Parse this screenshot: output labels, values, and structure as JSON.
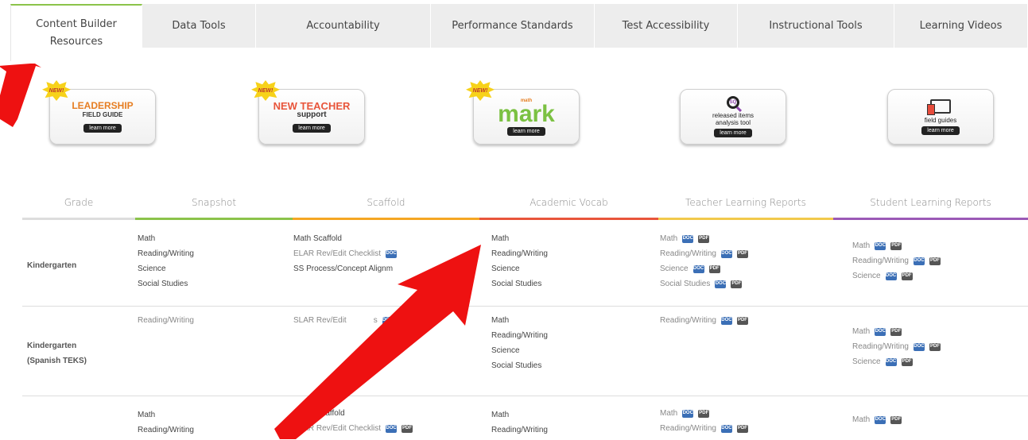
{
  "tabs": [
    {
      "label": "Content Builder\nResources",
      "active": true
    },
    {
      "label": "Data Tools"
    },
    {
      "label": "Accountability"
    },
    {
      "label": "Performance Standards"
    },
    {
      "label": "Test Accessibility"
    },
    {
      "label": "Instructional Tools"
    },
    {
      "label": "Learning Videos"
    }
  ],
  "banners": {
    "badge": "NEW!",
    "learn_more": "learn more",
    "leadership": {
      "title": "LEADERSHIP",
      "sub": "FIELD GUIDE"
    },
    "new_teacher": {
      "title": "NEW TEACHER",
      "sub": "support"
    },
    "math_mark": {
      "top": "math",
      "title": "mark"
    },
    "released": {
      "icon": "SQ",
      "text": "released items\nanalysis tool"
    },
    "field_guides": {
      "text": "field guides"
    }
  },
  "table": {
    "headers": [
      "Grade",
      "Snapshot",
      "Scaffold",
      "Academic Vocab",
      "Teacher Learning Reports",
      "Student Learning Reports"
    ],
    "bar_colors": [
      "#5bc0eb",
      "#8bc34a",
      "#f5a623",
      "#e8553b",
      "#f2c94c",
      "#9b59b6"
    ],
    "icon_labels": {
      "download": "DOC",
      "pdf": "PDF"
    },
    "rows": [
      {
        "grade": "Kindergarten",
        "snapshot": [
          "Math",
          "Reading/Writing",
          "Science",
          "Social Studies"
        ],
        "scaffold": [
          "Math Scaffold",
          "ELAR Rev/Edit Checklist",
          "SS Process/Concept Alignm"
        ],
        "vocab": [
          "Math",
          "Reading/Writing",
          "Science",
          "Social Studies"
        ],
        "teacher": [
          "Math",
          "Reading/Writing",
          "Science",
          "Social Studies"
        ],
        "student": [
          "Math",
          "Reading/Writing",
          "Science"
        ]
      },
      {
        "grade": "Kindergarten",
        "grade2": "(Spanish TEKS)",
        "snapshot": [
          "Reading/Writing"
        ],
        "scaffold": [
          "SLAR Rev/Edit",
          "s"
        ],
        "vocab": [
          "Math",
          "Reading/Writing",
          "Science",
          "Social Studies"
        ],
        "teacher": [
          "Reading/Writing"
        ],
        "student": [
          "Math",
          "Reading/Writing",
          "Science"
        ]
      },
      {
        "grade": "",
        "snapshot": [
          "Math",
          "Reading/Writing"
        ],
        "scaffold": [
          "ath Scaffold",
          "ELAR Rev/Edit Checklist"
        ],
        "vocab": [
          "Math",
          "Reading/Writing"
        ],
        "teacher": [
          "Math",
          "Reading/Writing"
        ],
        "student": [
          "Math"
        ]
      }
    ]
  },
  "arrow_color": "#ee1111"
}
